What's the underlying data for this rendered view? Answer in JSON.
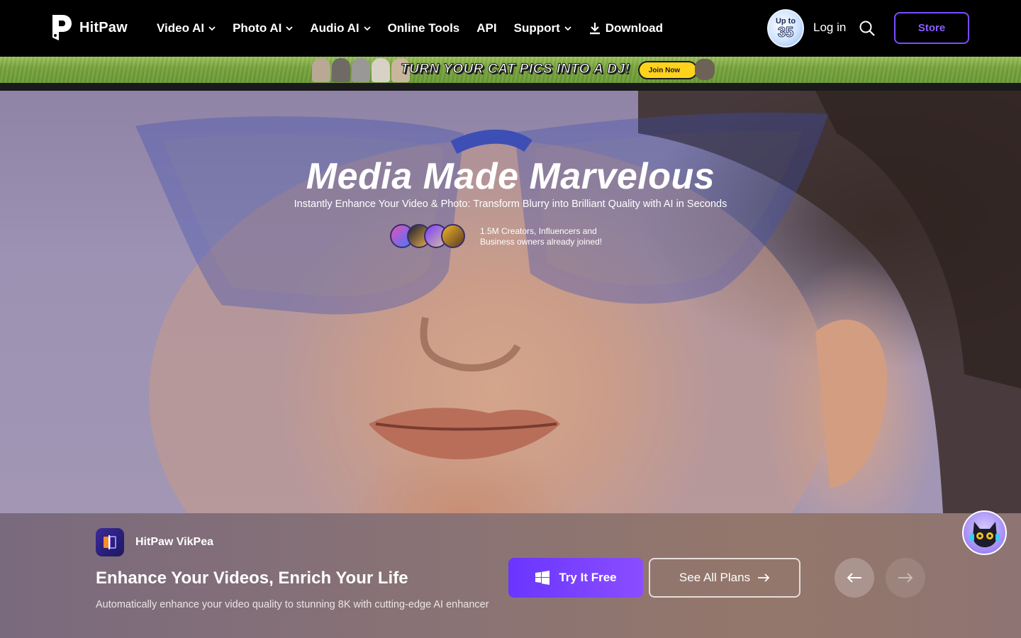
{
  "nav": {
    "brand": "HitPaw",
    "items": [
      {
        "label": "Video AI",
        "dropdown": true
      },
      {
        "label": "Photo AI",
        "dropdown": true
      },
      {
        "label": "Audio AI",
        "dropdown": true
      },
      {
        "label": "Online Tools",
        "dropdown": false
      },
      {
        "label": "API",
        "dropdown": false
      },
      {
        "label": "Support",
        "dropdown": true
      }
    ],
    "download_label": "Download",
    "promo_up": "Up to",
    "promo_num": "35",
    "login_label": "Log in",
    "store_label": "Store"
  },
  "banner": {
    "text": "TURN YOUR CAT PICS INTO A DJ!",
    "button_label": "Join Now"
  },
  "hero": {
    "title": "Media Made Marvelous",
    "subtitle": "Instantly Enhance Your Video & Photo: Transform Blurry into Brilliant Quality with AI in Seconds",
    "social_proof_line1": "1.5M Creators, Influencers and",
    "social_proof_line2": "Business owners already joined!"
  },
  "panel": {
    "product_name": "HitPaw VikPea",
    "title": "Enhance Your Videos, Enrich Your Life",
    "description": "Automatically enhance your video quality to stunning 8K with cutting-edge AI enhancer",
    "try_label": "Try It Free",
    "plans_label": "See All Plans"
  },
  "colors": {
    "accent": "#7a4cff",
    "nav_bg": "#000000",
    "banner_button": "#ffd21c"
  },
  "icons": [
    "hitpaw-logo-icon",
    "chevron-down-icon",
    "download-icon",
    "search-icon",
    "windows-icon",
    "arrow-right-icon",
    "arrow-left-icon",
    "cat-mascot-icon"
  ]
}
